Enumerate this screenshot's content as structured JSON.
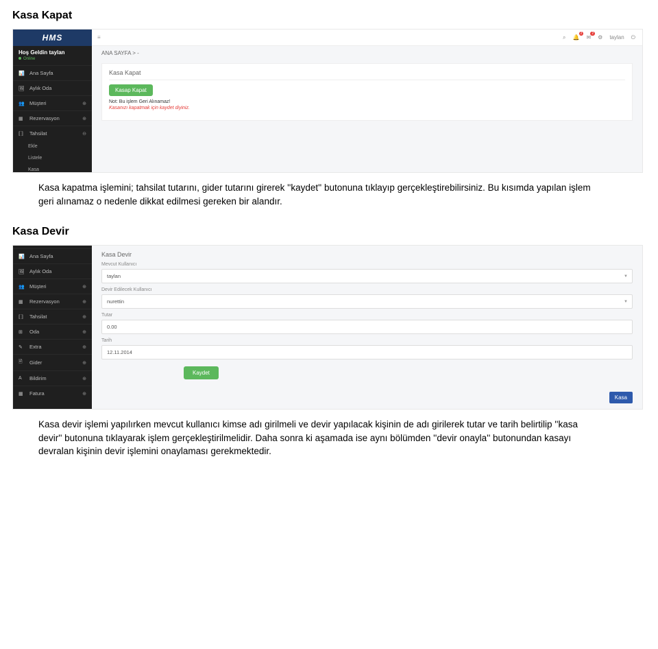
{
  "section1": {
    "title": "Kasa Kapat",
    "paragraph": "Kasa kapatma işlemini; tahsilat tutarını, gider tutarını girerek ''kaydet'' butonuna tıklayıp gerçekleştirebilirsiniz. Bu kısımda yapılan işlem geri alınamaz o nedenle dikkat edilmesi gereken bir alandır."
  },
  "section2": {
    "title": "Kasa Devir",
    "paragraph": "Kasa devir işlemi yapılırken mevcut kullanıcı kimse adı girilmeli ve devir yapılacak kişinin de adı girilerek tutar ve tarih belirtilip ''kasa devir'' butonuna tıklayarak işlem gerçekleştirilmelidir. Daha sonra ki aşamada ise aynı bölümden ''devir onayla'' butonundan kasayı devralan kişinin devir işlemini onaylaması gerekmektedir."
  },
  "shot1": {
    "logo": "HMS",
    "welcome": "Hoş Geldin taylan",
    "online": "Online",
    "menu_anasayfa": "Ana Sayfa",
    "menu_aylikoda": "Aylık Oda",
    "menu_musteri": "Müşteri",
    "menu_rezervasyon": "Rezervasyon",
    "menu_tahsilat": "Tahsilat",
    "sub_ekle": "Ekle",
    "sub_listele": "Listele",
    "sub_kasa": "Kasa",
    "tb_user": "taylan",
    "tb_badge": "2",
    "crumb": "ANA SAYFA  >  -",
    "panel_title": "Kasa Kapat",
    "btn": "Kasap Kapat",
    "note1": "Not: Bu işlem Geri Alınamaz!",
    "note2": "Kasanızı kapatmak için kaydet diyiniz."
  },
  "shot2": {
    "menu_anasayfa": "Ana Sayfa",
    "menu_aylikoda": "Aylık Oda",
    "menu_musteri": "Müşteri",
    "menu_rezervasyon": "Rezervasyon",
    "menu_tahsilat": "Tahsilat",
    "menu_oda": "Oda",
    "menu_extra": "Extra",
    "menu_gider": "Gider",
    "menu_bildirim": "Bildirim",
    "menu_fatura": "Fatura",
    "title": "Kasa Devir",
    "lbl_mevcut": "Mevcut Kullanıcı",
    "val_mevcut": "taylan",
    "lbl_devir": "Devir Edilecek Kullanıcı",
    "val_devir": "nurettin",
    "lbl_tutar": "Tutar",
    "val_tutar": "0.00",
    "lbl_tarih": "Tarih",
    "val_tarih": "12.11.2014",
    "btn_kaydet": "Kaydet",
    "btn_kasa": "Kasa"
  }
}
